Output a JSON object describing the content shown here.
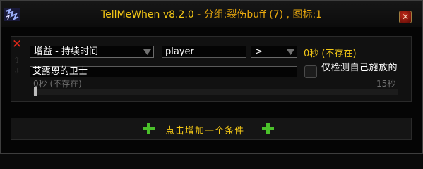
{
  "window": {
    "title_app": "TellMeWhen v8.2.0",
    "title_group": " - 分组:裂伤buff (7) ,",
    "title_icon": " 图标:1",
    "close_icon": "close-x-icon"
  },
  "condition": {
    "type_label": "增益 - 持续时间",
    "unit_value": "player",
    "operator_label": ">",
    "value_text": "0秒 (不存在)",
    "name_value": "艾露恩的卫士",
    "own_only_label": "仅检测自己施放的",
    "slider_min_label": "0秒 (不存在)",
    "slider_max_label": "15秒",
    "slider_value": 0
  },
  "add_condition": {
    "label": "点击增加一个条件"
  },
  "colors": {
    "accent": "#f3c716",
    "plus": "#4ac02a",
    "delete": "#e02818"
  }
}
